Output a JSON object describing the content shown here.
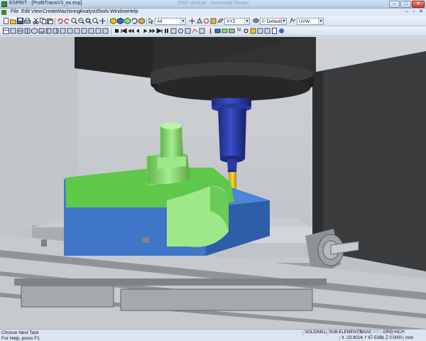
{
  "window": {
    "title": "ESPRIT - [ProfitTransV3_ex.esp]",
    "title_ghost": "PRO Vertical - Horizontal Router",
    "buttons": [
      "–",
      "□",
      "✕"
    ]
  },
  "menubar": {
    "items": [
      "File",
      "Edit",
      "View",
      "Create",
      "Machining",
      "Analysis",
      "Tools",
      "Window",
      "Help"
    ],
    "mdi_buttons": [
      "–",
      "▫",
      "✕"
    ]
  },
  "toolbar1": {
    "selection_filter": "All",
    "plane": "XYZ",
    "layer": "0 'Default'",
    "work_plane": "UVW"
  },
  "toolbar2": {
    "label": "N"
  },
  "statusbar": {
    "prompt": "Choose Next Task",
    "help": "For Help, press F1",
    "modes": [
      "SOLIDMILL",
      "SUB-ELEMENTS",
      "SNAP",
      "INT",
      "GRID",
      "INCH"
    ],
    "modes_dim": [
      false,
      false,
      false,
      true,
      false,
      false
    ],
    "x": "X -23.9014",
    "y": "Y 67.5386",
    "z": "Z 0.0000",
    "unit": "Inch"
  },
  "colors": {
    "stock": "#3f76c8",
    "part": "#8ee07a",
    "spindle": "#2a3a9a",
    "tool": "#e8c81a",
    "machine": "#2a2a2a",
    "table": "#b8bcc0"
  },
  "icons": [
    "new-icon",
    "open-icon",
    "save-icon",
    "print-icon",
    "cut-icon",
    "copy-icon",
    "paste-icon",
    "undo-icon",
    "redo-icon",
    "pan-icon",
    "zoom-in-icon",
    "zoom-out-icon",
    "zoom-window-icon",
    "zoom-fit-icon",
    "rotate-icon",
    "shade-icon",
    "wireframe-icon",
    "simulate-icon",
    "play-icon",
    "pause-icon",
    "stop-icon",
    "step-icon",
    "rewind-icon",
    "fast-forward-icon"
  ]
}
